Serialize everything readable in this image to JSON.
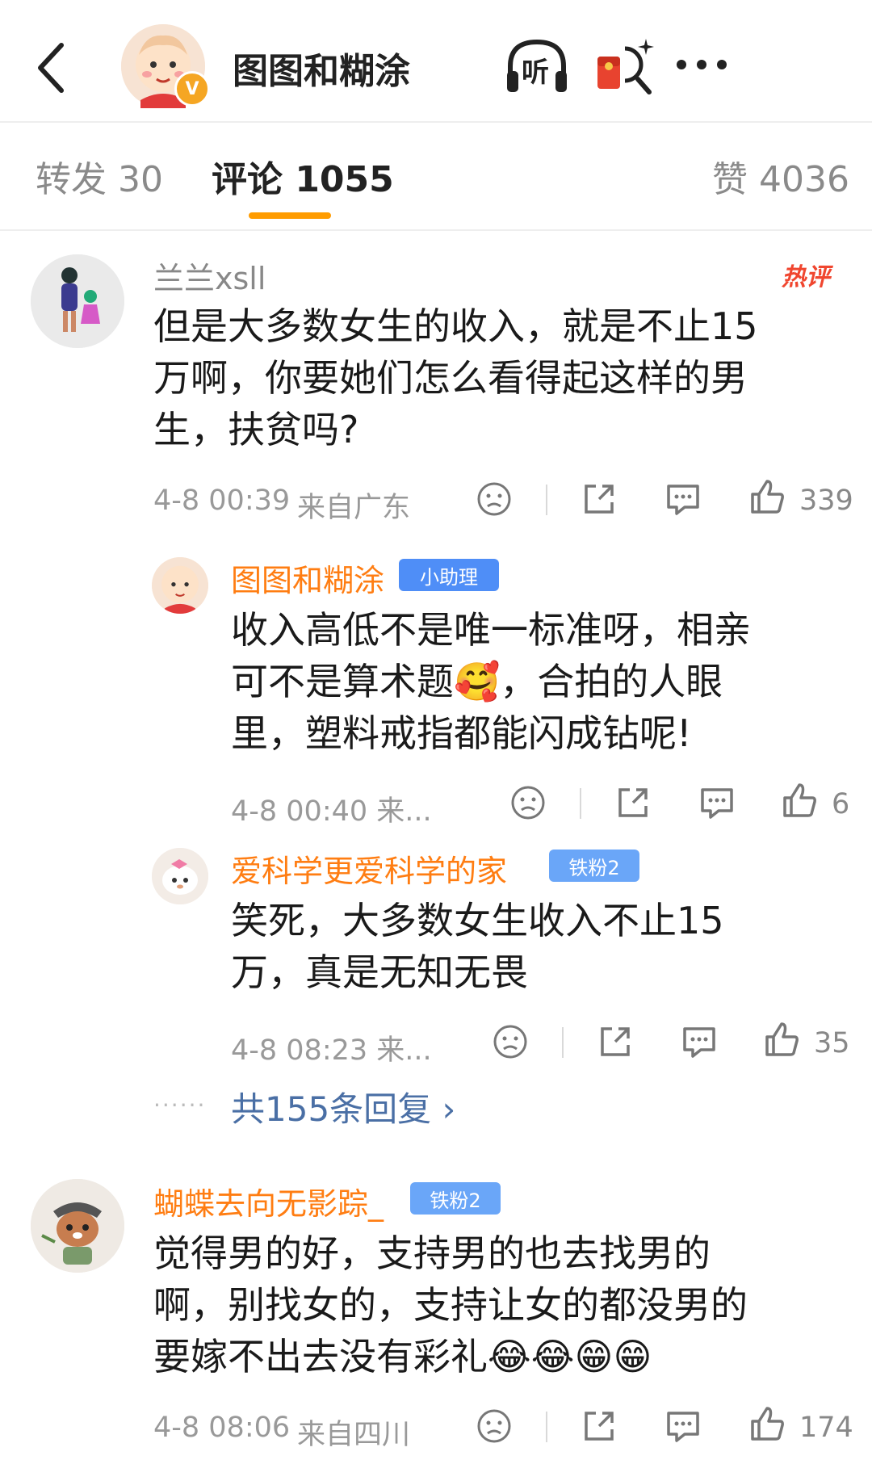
{
  "header": {
    "account_name": "图图和糊涂",
    "listen_label": "听"
  },
  "tabs": [
    {
      "label": "转发 30"
    },
    {
      "label": "评论 1055"
    },
    {
      "label": "赞 4036"
    }
  ],
  "comments": [
    {
      "user": "兰兰xsll",
      "hot_tag": "热评",
      "text_lines": [
        "但是大多数女生的收入，就是不止15",
        "万啊，你要她们怎么看得起这样的男",
        "生，扶贫吗?"
      ],
      "time": "4-8 00:39",
      "location": "来自广东",
      "likes": "339",
      "replies": [
        {
          "user": "图图和糊涂",
          "badge": "小助理",
          "text_lines": [
            "收入高低不是唯一标准呀，相亲",
            "可不是算术题🥰，合拍的人眼",
            "里，塑料戒指都能闪成钻呢!"
          ],
          "time": "4-8 00:40 来...",
          "likes": "6"
        },
        {
          "user": "爱科学更爱科学的家",
          "badge": "铁粉2",
          "text_lines": [
            "笑死，大多数女生收入不止15",
            "万，真是无知无畏"
          ],
          "time": "4-8 08:23 来...",
          "likes": "35"
        }
      ],
      "more_replies": "共155条回复 ›",
      "more_dots": "······"
    },
    {
      "user": "蝴蝶去向无影踪_",
      "badge": "铁粉2",
      "text_lines": [
        "觉得男的好，支持男的也去找男的",
        "啊，别找女的，支持让女的都没男的",
        "要嫁不出去没有彩礼😂😂😁😁"
      ],
      "time": "4-8 08:06",
      "location": "来自四川",
      "likes": "174"
    }
  ],
  "colors": {
    "accent": "#ff9c00",
    "username": "#ff7d12",
    "link": "#4a6fa5",
    "badge_blue": "#4f8ef7",
    "badge_fan": "#6aa6f8"
  },
  "icons": [
    "back-arrow-icon",
    "verified-icon",
    "headphone-icon",
    "red-packet-search-icon",
    "more-icon",
    "dislike-icon",
    "share-icon",
    "comment-icon",
    "like-icon"
  ]
}
